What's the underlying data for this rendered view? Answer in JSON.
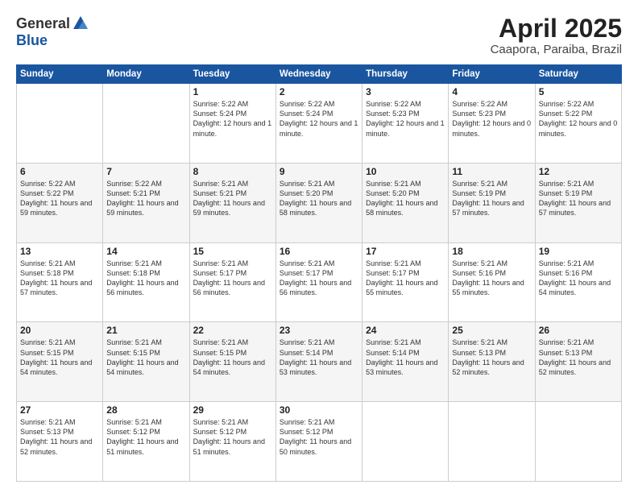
{
  "logo": {
    "general": "General",
    "blue": "Blue"
  },
  "header": {
    "month": "April 2025",
    "location": "Caapora, Paraiba, Brazil"
  },
  "days_of_week": [
    "Sunday",
    "Monday",
    "Tuesday",
    "Wednesday",
    "Thursday",
    "Friday",
    "Saturday"
  ],
  "weeks": [
    [
      {
        "day": "",
        "info": ""
      },
      {
        "day": "",
        "info": ""
      },
      {
        "day": "1",
        "info": "Sunrise: 5:22 AM\nSunset: 5:24 PM\nDaylight: 12 hours\nand 1 minute."
      },
      {
        "day": "2",
        "info": "Sunrise: 5:22 AM\nSunset: 5:24 PM\nDaylight: 12 hours\nand 1 minute."
      },
      {
        "day": "3",
        "info": "Sunrise: 5:22 AM\nSunset: 5:23 PM\nDaylight: 12 hours\nand 1 minute."
      },
      {
        "day": "4",
        "info": "Sunrise: 5:22 AM\nSunset: 5:23 PM\nDaylight: 12 hours\nand 0 minutes."
      },
      {
        "day": "5",
        "info": "Sunrise: 5:22 AM\nSunset: 5:22 PM\nDaylight: 12 hours\nand 0 minutes."
      }
    ],
    [
      {
        "day": "6",
        "info": "Sunrise: 5:22 AM\nSunset: 5:22 PM\nDaylight: 11 hours\nand 59 minutes."
      },
      {
        "day": "7",
        "info": "Sunrise: 5:22 AM\nSunset: 5:21 PM\nDaylight: 11 hours\nand 59 minutes."
      },
      {
        "day": "8",
        "info": "Sunrise: 5:21 AM\nSunset: 5:21 PM\nDaylight: 11 hours\nand 59 minutes."
      },
      {
        "day": "9",
        "info": "Sunrise: 5:21 AM\nSunset: 5:20 PM\nDaylight: 11 hours\nand 58 minutes."
      },
      {
        "day": "10",
        "info": "Sunrise: 5:21 AM\nSunset: 5:20 PM\nDaylight: 11 hours\nand 58 minutes."
      },
      {
        "day": "11",
        "info": "Sunrise: 5:21 AM\nSunset: 5:19 PM\nDaylight: 11 hours\nand 57 minutes."
      },
      {
        "day": "12",
        "info": "Sunrise: 5:21 AM\nSunset: 5:19 PM\nDaylight: 11 hours\nand 57 minutes."
      }
    ],
    [
      {
        "day": "13",
        "info": "Sunrise: 5:21 AM\nSunset: 5:18 PM\nDaylight: 11 hours\nand 57 minutes."
      },
      {
        "day": "14",
        "info": "Sunrise: 5:21 AM\nSunset: 5:18 PM\nDaylight: 11 hours\nand 56 minutes."
      },
      {
        "day": "15",
        "info": "Sunrise: 5:21 AM\nSunset: 5:17 PM\nDaylight: 11 hours\nand 56 minutes."
      },
      {
        "day": "16",
        "info": "Sunrise: 5:21 AM\nSunset: 5:17 PM\nDaylight: 11 hours\nand 56 minutes."
      },
      {
        "day": "17",
        "info": "Sunrise: 5:21 AM\nSunset: 5:17 PM\nDaylight: 11 hours\nand 55 minutes."
      },
      {
        "day": "18",
        "info": "Sunrise: 5:21 AM\nSunset: 5:16 PM\nDaylight: 11 hours\nand 55 minutes."
      },
      {
        "day": "19",
        "info": "Sunrise: 5:21 AM\nSunset: 5:16 PM\nDaylight: 11 hours\nand 54 minutes."
      }
    ],
    [
      {
        "day": "20",
        "info": "Sunrise: 5:21 AM\nSunset: 5:15 PM\nDaylight: 11 hours\nand 54 minutes."
      },
      {
        "day": "21",
        "info": "Sunrise: 5:21 AM\nSunset: 5:15 PM\nDaylight: 11 hours\nand 54 minutes."
      },
      {
        "day": "22",
        "info": "Sunrise: 5:21 AM\nSunset: 5:15 PM\nDaylight: 11 hours\nand 54 minutes."
      },
      {
        "day": "23",
        "info": "Sunrise: 5:21 AM\nSunset: 5:14 PM\nDaylight: 11 hours\nand 53 minutes."
      },
      {
        "day": "24",
        "info": "Sunrise: 5:21 AM\nSunset: 5:14 PM\nDaylight: 11 hours\nand 53 minutes."
      },
      {
        "day": "25",
        "info": "Sunrise: 5:21 AM\nSunset: 5:13 PM\nDaylight: 11 hours\nand 52 minutes."
      },
      {
        "day": "26",
        "info": "Sunrise: 5:21 AM\nSunset: 5:13 PM\nDaylight: 11 hours\nand 52 minutes."
      }
    ],
    [
      {
        "day": "27",
        "info": "Sunrise: 5:21 AM\nSunset: 5:13 PM\nDaylight: 11 hours\nand 52 minutes."
      },
      {
        "day": "28",
        "info": "Sunrise: 5:21 AM\nSunset: 5:12 PM\nDaylight: 11 hours\nand 51 minutes."
      },
      {
        "day": "29",
        "info": "Sunrise: 5:21 AM\nSunset: 5:12 PM\nDaylight: 11 hours\nand 51 minutes."
      },
      {
        "day": "30",
        "info": "Sunrise: 5:21 AM\nSunset: 5:12 PM\nDaylight: 11 hours\nand 50 minutes."
      },
      {
        "day": "",
        "info": ""
      },
      {
        "day": "",
        "info": ""
      },
      {
        "day": "",
        "info": ""
      }
    ]
  ]
}
